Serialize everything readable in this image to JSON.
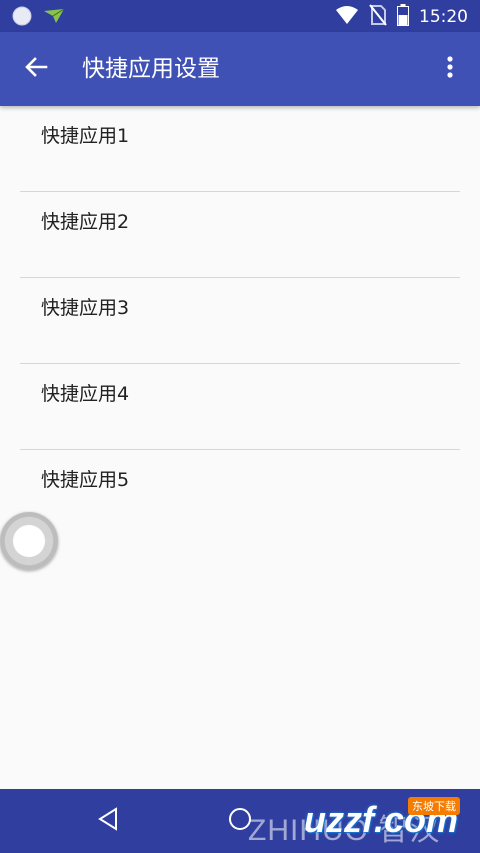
{
  "status_bar": {
    "time": "15:20",
    "icons": [
      "notification-circle-icon",
      "app-notification-icon",
      "wifi-icon",
      "no-sim-icon",
      "battery-icon"
    ]
  },
  "app_bar": {
    "title": "快捷应用设置",
    "back_icon": "arrow-back-icon",
    "more_icon": "more-vert-icon",
    "color": "#3f51b5",
    "status_color": "#303f9f"
  },
  "list": {
    "items": [
      {
        "label": "快捷应用1"
      },
      {
        "label": "快捷应用2"
      },
      {
        "label": "快捷应用3"
      },
      {
        "label": "快捷应用4"
      },
      {
        "label": "快捷应用5"
      }
    ]
  },
  "nav_bar": {
    "back_icon": "triangle-back-icon",
    "home_icon": "circle-home-icon",
    "color": "#303f9f"
  },
  "watermark": {
    "text": "ZHIHUO 智汉",
    "logo": "uzzf.com",
    "badge": "东坡下载"
  }
}
